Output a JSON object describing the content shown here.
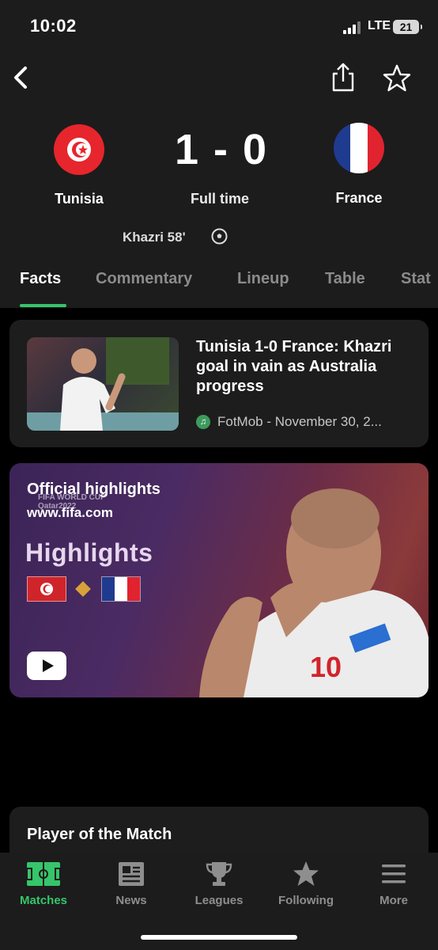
{
  "status_bar": {
    "time": "10:02",
    "network": "LTE",
    "battery": "21"
  },
  "match": {
    "home_team": "Tunisia",
    "away_team": "France",
    "score": "1 - 0",
    "status": "Full time",
    "scorer": "Khazri 58'"
  },
  "tabs": [
    "Facts",
    "Commentary",
    "Lineup",
    "Table",
    "Stat"
  ],
  "news": {
    "title": "Tunisia 1-0 France: Khazri goal in vain as Australia progress",
    "source": "FotMob - November 30, 2..."
  },
  "video": {
    "title": "Official highlights",
    "url": "www.fifa.com",
    "badge_line1": "FIFA WORLD CUP",
    "badge_line2": "Qatar2022",
    "highlights_text": "Highlights"
  },
  "player_of_match": {
    "title": "Player of the Match"
  },
  "bottom_nav": [
    {
      "label": "Matches",
      "icon": "pitch-icon"
    },
    {
      "label": "News",
      "icon": "newspaper-icon"
    },
    {
      "label": "Leagues",
      "icon": "trophy-icon"
    },
    {
      "label": "Following",
      "icon": "star-icon"
    },
    {
      "label": "More",
      "icon": "menu-icon"
    }
  ],
  "colors": {
    "accent": "#36c56a",
    "background": "#000000",
    "surface": "#1d1d1d",
    "header": "#1c1c1c"
  }
}
